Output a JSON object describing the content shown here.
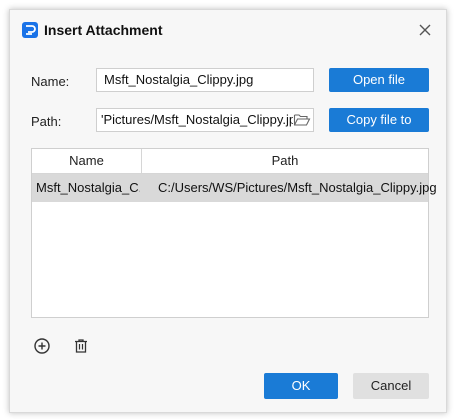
{
  "dialog": {
    "title": "Insert Attachment",
    "icon": "app-logo-icon",
    "close_icon": "close-icon"
  },
  "form": {
    "name_label": "Name:",
    "name_value": "Msft_Nostalgia_Clippy.jpg",
    "path_label": "Path:",
    "path_value": "'Pictures/Msft_Nostalgia_Clippy.jpg",
    "folder_icon": "folder-open-icon"
  },
  "buttons": {
    "open_file": "Open file",
    "copy_file_to": "Copy file to",
    "ok": "OK",
    "cancel": "Cancel"
  },
  "table": {
    "columns": [
      "Name",
      "Path"
    ],
    "rows": [
      {
        "name": "Msft_Nostalgia_C...",
        "path": "C:/Users/WS/Pictures/Msft_Nostalgia_Clippy.jpg",
        "selected": true
      }
    ]
  },
  "toolbar": {
    "add_icon": "add-circle-icon",
    "delete_icon": "trash-icon"
  },
  "colors": {
    "primary": "#1a7bd6",
    "selected_row": "#d9d9d9",
    "dialog_bg": "#f7f7f7"
  }
}
